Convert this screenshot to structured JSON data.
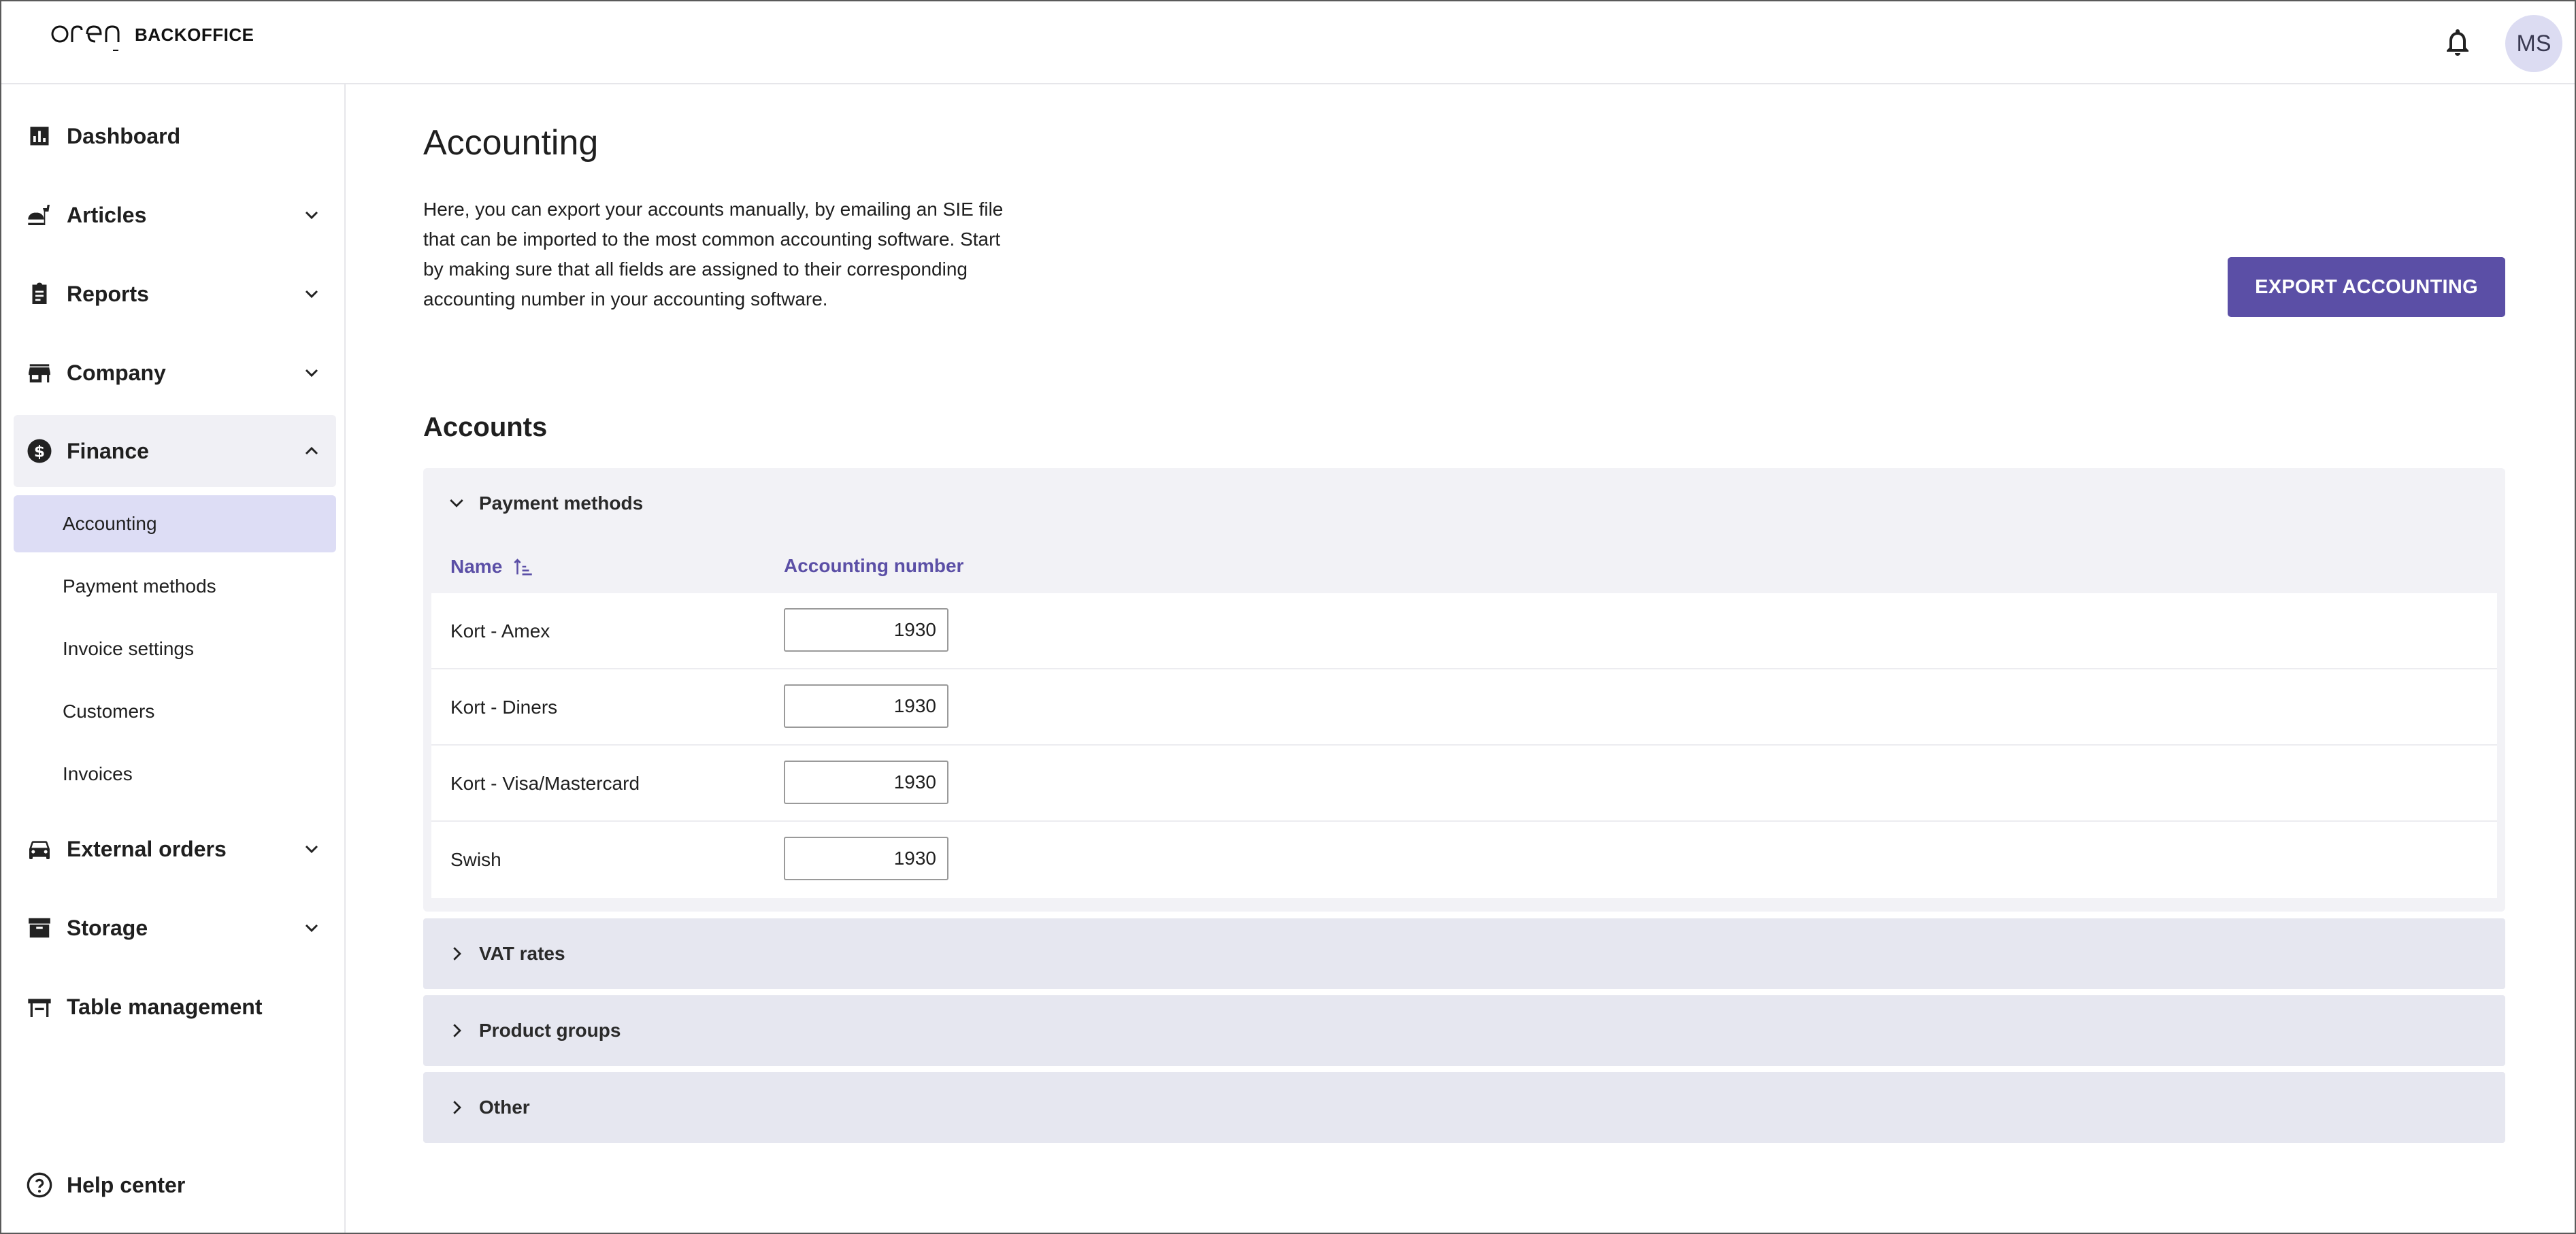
{
  "header": {
    "logo_text": "OPEN",
    "logo_suffix": "BACKOFFICE",
    "avatar_initials": "MS"
  },
  "sidebar": {
    "items": [
      {
        "label": "Dashboard",
        "icon": "bar-chart-icon",
        "expandable": false
      },
      {
        "label": "Articles",
        "icon": "food-icon",
        "expandable": true
      },
      {
        "label": "Reports",
        "icon": "clipboard-icon",
        "expandable": true
      },
      {
        "label": "Company",
        "icon": "store-icon",
        "expandable": true
      },
      {
        "label": "Finance",
        "icon": "dollar-circle-icon",
        "expandable": true,
        "expanded": true
      },
      {
        "label": "External orders",
        "icon": "car-icon",
        "expandable": true
      },
      {
        "label": "Storage",
        "icon": "archive-box-icon",
        "expandable": true
      },
      {
        "label": "Table management",
        "icon": "table-icon",
        "expandable": false
      }
    ],
    "finance_sub": [
      {
        "label": "Accounting",
        "active": true
      },
      {
        "label": "Payment methods"
      },
      {
        "label": "Invoice settings"
      },
      {
        "label": "Customers"
      },
      {
        "label": "Invoices"
      }
    ],
    "help": "Help center"
  },
  "main": {
    "title": "Accounting",
    "description": "Here, you can export your accounts manually, by emailing an SIE file that can be imported to the most common accounting software. Start by making sure that all fields are assigned to their corresponding accounting number in your accounting software.",
    "export_button": "EXPORT ACCOUNTING",
    "section_title": "Accounts",
    "payment_panel": {
      "title": "Payment methods",
      "col_name": "Name",
      "col_number": "Accounting number",
      "rows": [
        {
          "name": "Kort - Amex",
          "number": "1930"
        },
        {
          "name": "Kort - Diners",
          "number": "1930"
        },
        {
          "name": "Kort - Visa/Mastercard",
          "number": "1930"
        },
        {
          "name": "Swish",
          "number": "1930"
        }
      ]
    },
    "collapsed_panels": [
      "VAT rates",
      "Product groups",
      "Other"
    ]
  },
  "colors": {
    "accent": "#5b4fa6",
    "active_nav_bg": "#ddddf5",
    "panel_bg": "#f2f2f6",
    "collapsed_bg": "#e6e7f0"
  }
}
